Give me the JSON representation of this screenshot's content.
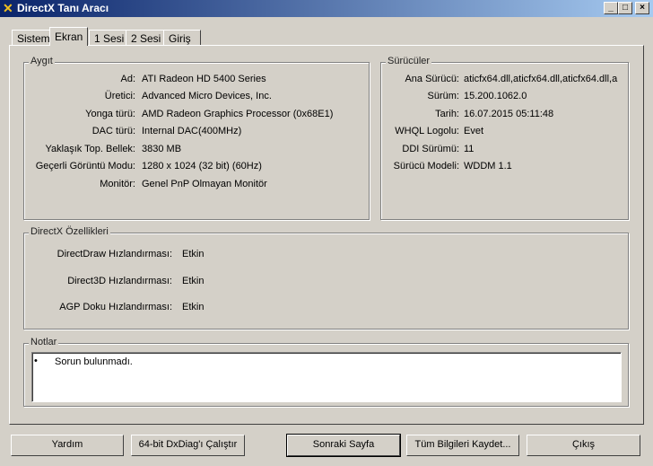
{
  "window": {
    "title": "DirectX Tanı Aracı",
    "minimize": "_",
    "maximize": "□",
    "close": "×"
  },
  "tabs": [
    {
      "label": "Sistem"
    },
    {
      "label": "Ekran"
    },
    {
      "label": "1 Sesi"
    },
    {
      "label": "2 Sesi"
    },
    {
      "label": "Giriş"
    }
  ],
  "device": {
    "title": "Aygıt",
    "rows": [
      {
        "label": "Ad:",
        "value": "ATI Radeon HD 5400 Series"
      },
      {
        "label": "Üretici:",
        "value": "Advanced Micro Devices, Inc."
      },
      {
        "label": "Yonga türü:",
        "value": "AMD Radeon Graphics Processor (0x68E1)"
      },
      {
        "label": "DAC türü:",
        "value": "Internal DAC(400MHz)"
      },
      {
        "label": "Yaklaşık Top. Bellek:",
        "value": "3830 MB"
      },
      {
        "label": "Geçerli Görüntü Modu:",
        "value": "1280 x 1024 (32 bit) (60Hz)"
      },
      {
        "label": "Monitör:",
        "value": "Genel PnP Olmayan Monitör"
      }
    ]
  },
  "drivers": {
    "title": "Sürücüler",
    "rows": [
      {
        "label": "Ana Sürücü:",
        "value": "aticfx64.dll,aticfx64.dll,aticfx64.dll,a"
      },
      {
        "label": "Sürüm:",
        "value": "15.200.1062.0"
      },
      {
        "label": "Tarih:",
        "value": "16.07.2015 05:11:48"
      },
      {
        "label": "WHQL Logolu:",
        "value": "Evet"
      },
      {
        "label": "DDI Sürümü:",
        "value": "11"
      },
      {
        "label": "Sürücü Modeli:",
        "value": "WDDM 1.1"
      }
    ]
  },
  "features": {
    "title": "DirectX Özellikleri",
    "rows": [
      {
        "label": "DirectDraw Hızlandırması:",
        "value": "Etkin"
      },
      {
        "label": "Direct3D Hızlandırması:",
        "value": "Etkin"
      },
      {
        "label": "AGP Doku Hızlandırması:",
        "value": "Etkin"
      }
    ]
  },
  "notes": {
    "title": "Notlar",
    "items": [
      "Sorun bulunmadı."
    ]
  },
  "buttons": {
    "help": "Yardım",
    "run64": "64-bit DxDiag'ı Çalıştır",
    "next": "Sonraki Sayfa",
    "save": "Tüm Bilgileri Kaydet...",
    "exit": "Çıkış"
  }
}
